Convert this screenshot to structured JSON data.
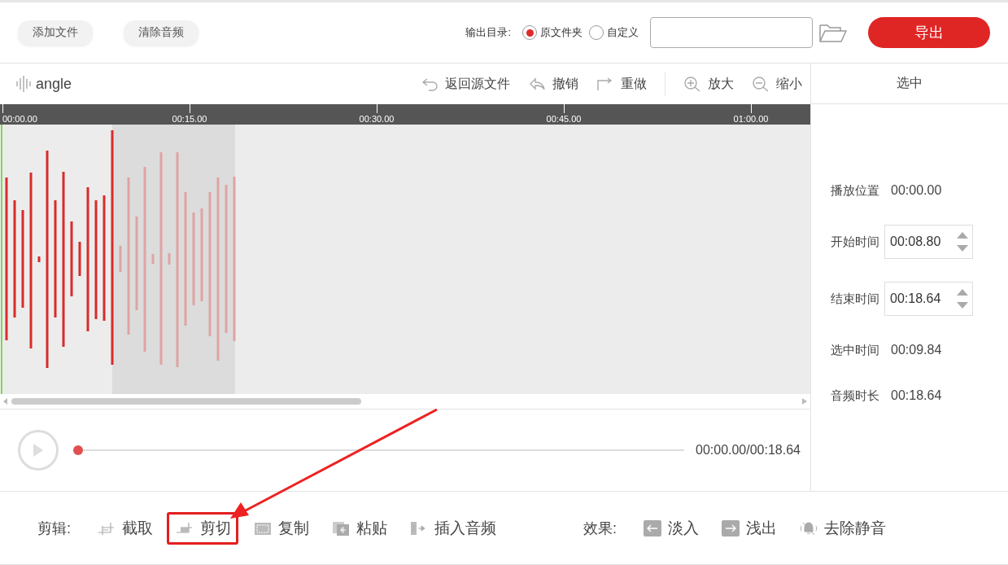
{
  "top_bar": {
    "buttons": [
      "添加文件",
      "清除音频"
    ],
    "output_label": "输出目录:",
    "output_options": [
      {
        "label": "原文件夹",
        "selected": true
      },
      {
        "label": "自定义",
        "selected": false
      }
    ],
    "export_button": "导出"
  },
  "editor": {
    "file_name": "angle",
    "actions": [
      {
        "label": "返回源文件",
        "kind": "back"
      },
      {
        "label": "撤销",
        "kind": "undo"
      },
      {
        "label": "重做",
        "kind": "redo"
      },
      {
        "label": "放大",
        "kind": "zoom-in"
      },
      {
        "label": "缩小",
        "kind": "zoom-out"
      }
    ],
    "ruler": [
      "00:00.00",
      "00:15.00",
      "00:30.00",
      "00:45.00",
      "01:00.00"
    ],
    "player": {
      "level": 0,
      "time": "00:00.00/00:18.64"
    }
  },
  "side_panel": {
    "title": "选中",
    "fields": [
      {
        "label": "播放位置",
        "value": "00:00.00",
        "kind": "text"
      },
      {
        "label": "开始时间",
        "value": "00:08.80",
        "kind": "spinner"
      },
      {
        "label": "结束时间",
        "value": "00:18.64",
        "kind": "spinner"
      },
      {
        "label": "选中时间",
        "value": "00:09.84",
        "kind": "text"
      },
      {
        "label": "音频时长",
        "value": "00:18.64",
        "kind": "text"
      }
    ]
  },
  "bottom_bar": {
    "edit_label": "剪辑:",
    "edit_tools": [
      {
        "label": "截取",
        "kind": "crop",
        "highlighted": false
      },
      {
        "label": "剪切",
        "kind": "cut",
        "highlighted": true
      },
      {
        "label": "复制",
        "kind": "copy",
        "highlighted": false
      },
      {
        "label": "粘贴",
        "kind": "paste",
        "highlighted": false
      },
      {
        "label": "插入音频",
        "kind": "insert",
        "highlighted": false
      }
    ],
    "effects_label": "效果:",
    "effect_tools": [
      {
        "label": "淡入",
        "kind": "fade-in"
      },
      {
        "label": "浅出",
        "kind": "fade-out"
      },
      {
        "label": "去除静音",
        "kind": "mute"
      }
    ]
  }
}
